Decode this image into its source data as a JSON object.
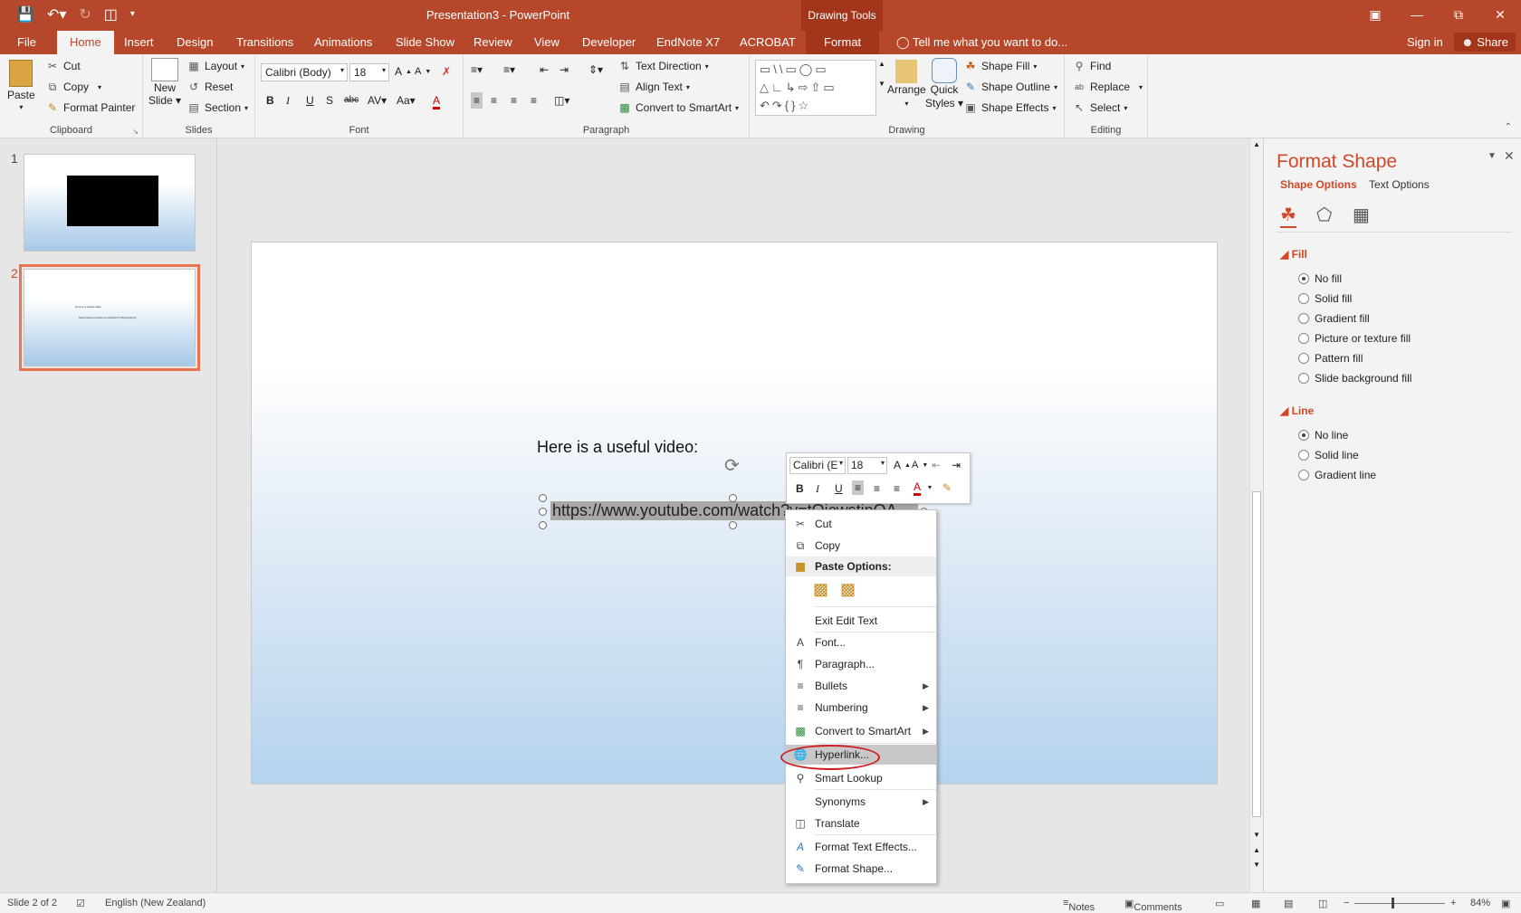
{
  "window": {
    "title": "Presentation3 - PowerPoint",
    "contextual_header": "Drawing Tools"
  },
  "tabs": {
    "file": "File",
    "home": "Home",
    "insert": "Insert",
    "design": "Design",
    "transitions": "Transitions",
    "animations": "Animations",
    "slideshow": "Slide Show",
    "review": "Review",
    "view": "View",
    "developer": "Developer",
    "endnote": "EndNote X7",
    "acrobat": "ACROBAT",
    "format": "Format",
    "tell_me": "Tell me what you want to do...",
    "sign_in": "Sign in",
    "share": "Share"
  },
  "ribbon": {
    "clipboard": {
      "label": "Clipboard",
      "paste": "Paste",
      "cut": "Cut",
      "copy": "Copy",
      "format_painter": "Format Painter"
    },
    "slides": {
      "label": "Slides",
      "new_slide_1": "New",
      "new_slide_2": "Slide",
      "layout": "Layout",
      "reset": "Reset",
      "section": "Section"
    },
    "font": {
      "label": "Font",
      "name": "Calibri (Body)",
      "size": "18"
    },
    "paragraph": {
      "label": "Paragraph",
      "text_direction": "Text Direction",
      "align_text": "Align Text",
      "convert_smartart": "Convert to SmartArt"
    },
    "drawing": {
      "label": "Drawing",
      "arrange": "Arrange",
      "quick_styles_1": "Quick",
      "quick_styles_2": "Styles",
      "shape_fill": "Shape Fill",
      "shape_outline": "Shape Outline",
      "shape_effects": "Shape Effects"
    },
    "editing": {
      "label": "Editing",
      "find": "Find",
      "replace": "Replace",
      "select": "Select"
    }
  },
  "thumbnails": [
    {
      "num": "1"
    },
    {
      "num": "2",
      "line1": "Here is a useful video:",
      "line2": "https://www.youtube.com/watch?v=tQicwstinQA"
    }
  ],
  "slide": {
    "heading": "Here is a useful video:",
    "url": "https://www.youtube.com/watch?v=tQicwstinQA"
  },
  "mini_toolbar": {
    "font": "Calibri (E",
    "size": "18"
  },
  "context_menu": {
    "cut": "Cut",
    "copy": "Copy",
    "paste_options": "Paste Options:",
    "exit_edit": "Exit Edit Text",
    "font": "Font...",
    "paragraph": "Paragraph...",
    "bullets": "Bullets",
    "numbering": "Numbering",
    "convert_smartart": "Convert to SmartArt",
    "hyperlink": "Hyperlink...",
    "smart_lookup": "Smart Lookup",
    "synonyms": "Synonyms",
    "translate": "Translate",
    "format_text_effects": "Format Text Effects...",
    "format_shape": "Format Shape..."
  },
  "format_pane": {
    "title": "Format Shape",
    "tab_shape": "Shape Options",
    "tab_text": "Text Options",
    "fill_header": "Fill",
    "fill_options": [
      "No fill",
      "Solid fill",
      "Gradient fill",
      "Picture or texture fill",
      "Pattern fill",
      "Slide background fill"
    ],
    "fill_selected": "No fill",
    "line_header": "Line",
    "line_options": [
      "No line",
      "Solid line",
      "Gradient line"
    ],
    "line_selected": "No line"
  },
  "statusbar": {
    "slide_info": "Slide 2 of 2",
    "language": "English (New Zealand)",
    "notes": "Notes",
    "comments": "Comments",
    "zoom": "84%"
  },
  "colors": {
    "accent": "#b7472a",
    "pane_accent": "#d24726",
    "highlight_circle": "#d02020"
  }
}
